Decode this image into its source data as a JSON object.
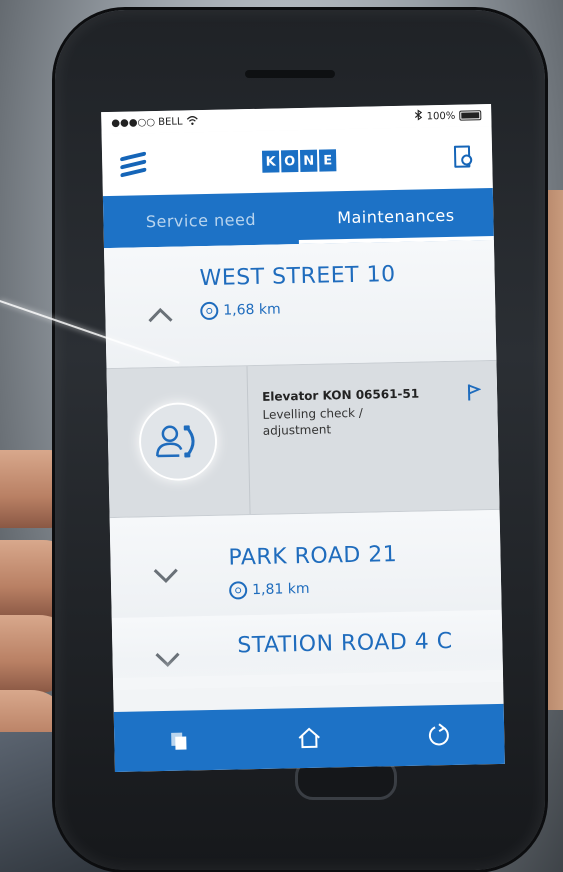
{
  "status_bar": {
    "carrier": "●●●○○ BELL",
    "battery": "100%"
  },
  "header": {
    "logo_letters": [
      "K",
      "O",
      "N",
      "E"
    ]
  },
  "tabs": [
    {
      "label": "Service need",
      "active": false
    },
    {
      "label": "Maintenances",
      "active": true
    }
  ],
  "sites": [
    {
      "name": "WEST STREET 10",
      "distance": "1,68 km",
      "expanded": true
    },
    {
      "name": "PARK ROAD 21",
      "distance": "1,81 km",
      "expanded": false
    },
    {
      "name": "STATION ROAD 4 C",
      "distance": "",
      "expanded": false
    }
  ],
  "maintenance_item": {
    "title": "Elevator KON 06561-51",
    "description": "Levelling check / adjustment"
  },
  "bottom_nav": [
    {
      "icon": "copy-icon"
    },
    {
      "icon": "home-icon"
    },
    {
      "icon": "refresh-icon"
    }
  ],
  "colors": {
    "brand_blue": "#1d72c6",
    "text_blue": "#1f6cbd"
  }
}
